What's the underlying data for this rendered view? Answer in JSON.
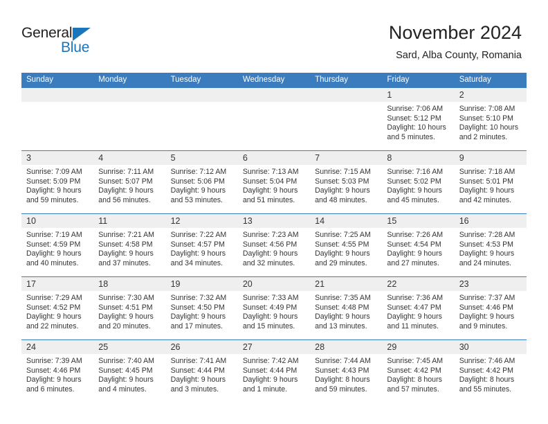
{
  "brand": {
    "name_part1": "General",
    "name_part2": "Blue",
    "accent_color": "#1b75bb",
    "triangle_icon": "triangle-icon"
  },
  "header": {
    "title": "November 2024",
    "subtitle": "Sard, Alba County, Romania"
  },
  "theme": {
    "header_blue": "#3b7cbe",
    "daynum_background": "#efefef",
    "text": "#333333"
  },
  "calendar": {
    "weekday_headers": [
      "Sunday",
      "Monday",
      "Tuesday",
      "Wednesday",
      "Thursday",
      "Friday",
      "Saturday"
    ],
    "weeks": [
      [
        {
          "day": "",
          "empty": true
        },
        {
          "day": "",
          "empty": true
        },
        {
          "day": "",
          "empty": true
        },
        {
          "day": "",
          "empty": true
        },
        {
          "day": "",
          "empty": true
        },
        {
          "day": "1",
          "sunrise": "Sunrise: 7:06 AM",
          "sunset": "Sunset: 5:12 PM",
          "daylight_line1": "Daylight: 10 hours",
          "daylight_line2": "and 5 minutes."
        },
        {
          "day": "2",
          "sunrise": "Sunrise: 7:08 AM",
          "sunset": "Sunset: 5:10 PM",
          "daylight_line1": "Daylight: 10 hours",
          "daylight_line2": "and 2 minutes."
        }
      ],
      [
        {
          "day": "3",
          "sunrise": "Sunrise: 7:09 AM",
          "sunset": "Sunset: 5:09 PM",
          "daylight_line1": "Daylight: 9 hours",
          "daylight_line2": "and 59 minutes."
        },
        {
          "day": "4",
          "sunrise": "Sunrise: 7:11 AM",
          "sunset": "Sunset: 5:07 PM",
          "daylight_line1": "Daylight: 9 hours",
          "daylight_line2": "and 56 minutes."
        },
        {
          "day": "5",
          "sunrise": "Sunrise: 7:12 AM",
          "sunset": "Sunset: 5:06 PM",
          "daylight_line1": "Daylight: 9 hours",
          "daylight_line2": "and 53 minutes."
        },
        {
          "day": "6",
          "sunrise": "Sunrise: 7:13 AM",
          "sunset": "Sunset: 5:04 PM",
          "daylight_line1": "Daylight: 9 hours",
          "daylight_line2": "and 51 minutes."
        },
        {
          "day": "7",
          "sunrise": "Sunrise: 7:15 AM",
          "sunset": "Sunset: 5:03 PM",
          "daylight_line1": "Daylight: 9 hours",
          "daylight_line2": "and 48 minutes."
        },
        {
          "day": "8",
          "sunrise": "Sunrise: 7:16 AM",
          "sunset": "Sunset: 5:02 PM",
          "daylight_line1": "Daylight: 9 hours",
          "daylight_line2": "and 45 minutes."
        },
        {
          "day": "9",
          "sunrise": "Sunrise: 7:18 AM",
          "sunset": "Sunset: 5:01 PM",
          "daylight_line1": "Daylight: 9 hours",
          "daylight_line2": "and 42 minutes."
        }
      ],
      [
        {
          "day": "10",
          "sunrise": "Sunrise: 7:19 AM",
          "sunset": "Sunset: 4:59 PM",
          "daylight_line1": "Daylight: 9 hours",
          "daylight_line2": "and 40 minutes."
        },
        {
          "day": "11",
          "sunrise": "Sunrise: 7:21 AM",
          "sunset": "Sunset: 4:58 PM",
          "daylight_line1": "Daylight: 9 hours",
          "daylight_line2": "and 37 minutes."
        },
        {
          "day": "12",
          "sunrise": "Sunrise: 7:22 AM",
          "sunset": "Sunset: 4:57 PM",
          "daylight_line1": "Daylight: 9 hours",
          "daylight_line2": "and 34 minutes."
        },
        {
          "day": "13",
          "sunrise": "Sunrise: 7:23 AM",
          "sunset": "Sunset: 4:56 PM",
          "daylight_line1": "Daylight: 9 hours",
          "daylight_line2": "and 32 minutes."
        },
        {
          "day": "14",
          "sunrise": "Sunrise: 7:25 AM",
          "sunset": "Sunset: 4:55 PM",
          "daylight_line1": "Daylight: 9 hours",
          "daylight_line2": "and 29 minutes."
        },
        {
          "day": "15",
          "sunrise": "Sunrise: 7:26 AM",
          "sunset": "Sunset: 4:54 PM",
          "daylight_line1": "Daylight: 9 hours",
          "daylight_line2": "and 27 minutes."
        },
        {
          "day": "16",
          "sunrise": "Sunrise: 7:28 AM",
          "sunset": "Sunset: 4:53 PM",
          "daylight_line1": "Daylight: 9 hours",
          "daylight_line2": "and 24 minutes."
        }
      ],
      [
        {
          "day": "17",
          "sunrise": "Sunrise: 7:29 AM",
          "sunset": "Sunset: 4:52 PM",
          "daylight_line1": "Daylight: 9 hours",
          "daylight_line2": "and 22 minutes."
        },
        {
          "day": "18",
          "sunrise": "Sunrise: 7:30 AM",
          "sunset": "Sunset: 4:51 PM",
          "daylight_line1": "Daylight: 9 hours",
          "daylight_line2": "and 20 minutes."
        },
        {
          "day": "19",
          "sunrise": "Sunrise: 7:32 AM",
          "sunset": "Sunset: 4:50 PM",
          "daylight_line1": "Daylight: 9 hours",
          "daylight_line2": "and 17 minutes."
        },
        {
          "day": "20",
          "sunrise": "Sunrise: 7:33 AM",
          "sunset": "Sunset: 4:49 PM",
          "daylight_line1": "Daylight: 9 hours",
          "daylight_line2": "and 15 minutes."
        },
        {
          "day": "21",
          "sunrise": "Sunrise: 7:35 AM",
          "sunset": "Sunset: 4:48 PM",
          "daylight_line1": "Daylight: 9 hours",
          "daylight_line2": "and 13 minutes."
        },
        {
          "day": "22",
          "sunrise": "Sunrise: 7:36 AM",
          "sunset": "Sunset: 4:47 PM",
          "daylight_line1": "Daylight: 9 hours",
          "daylight_line2": "and 11 minutes."
        },
        {
          "day": "23",
          "sunrise": "Sunrise: 7:37 AM",
          "sunset": "Sunset: 4:46 PM",
          "daylight_line1": "Daylight: 9 hours",
          "daylight_line2": "and 9 minutes."
        }
      ],
      [
        {
          "day": "24",
          "sunrise": "Sunrise: 7:39 AM",
          "sunset": "Sunset: 4:46 PM",
          "daylight_line1": "Daylight: 9 hours",
          "daylight_line2": "and 6 minutes."
        },
        {
          "day": "25",
          "sunrise": "Sunrise: 7:40 AM",
          "sunset": "Sunset: 4:45 PM",
          "daylight_line1": "Daylight: 9 hours",
          "daylight_line2": "and 4 minutes."
        },
        {
          "day": "26",
          "sunrise": "Sunrise: 7:41 AM",
          "sunset": "Sunset: 4:44 PM",
          "daylight_line1": "Daylight: 9 hours",
          "daylight_line2": "and 3 minutes."
        },
        {
          "day": "27",
          "sunrise": "Sunrise: 7:42 AM",
          "sunset": "Sunset: 4:44 PM",
          "daylight_line1": "Daylight: 9 hours",
          "daylight_line2": "and 1 minute."
        },
        {
          "day": "28",
          "sunrise": "Sunrise: 7:44 AM",
          "sunset": "Sunset: 4:43 PM",
          "daylight_line1": "Daylight: 8 hours",
          "daylight_line2": "and 59 minutes."
        },
        {
          "day": "29",
          "sunrise": "Sunrise: 7:45 AM",
          "sunset": "Sunset: 4:42 PM",
          "daylight_line1": "Daylight: 8 hours",
          "daylight_line2": "and 57 minutes."
        },
        {
          "day": "30",
          "sunrise": "Sunrise: 7:46 AM",
          "sunset": "Sunset: 4:42 PM",
          "daylight_line1": "Daylight: 8 hours",
          "daylight_line2": "and 55 minutes."
        }
      ]
    ]
  }
}
